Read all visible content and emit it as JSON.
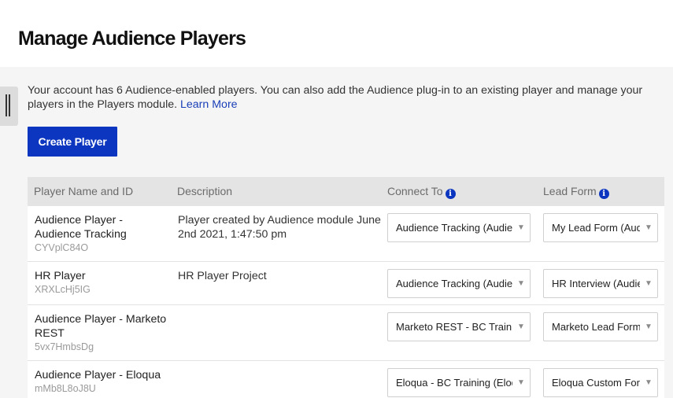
{
  "header": {
    "title": "Manage Audience Players"
  },
  "intro": {
    "text": "Your account has 6 Audience-enabled players. You can also add the Audience plug-in to an existing player and manage your players in the Players module.",
    "link": "Learn More"
  },
  "create_button": "Create Player",
  "table": {
    "columns": {
      "name": "Player Name and ID",
      "description": "Description",
      "connect": "Connect To",
      "lead": "Lead Form"
    },
    "rows": [
      {
        "name": "Audience Player - Audience Tracking",
        "id": "CYVplC84O",
        "description": "Player created by Audience module June 2nd 2021, 1:47:50 pm",
        "connect": "Audience Tracking (Audience)",
        "lead": "My Lead Form (Audience)"
      },
      {
        "name": "HR Player",
        "id": "XRXLcHj5IG",
        "description": "HR Player Project",
        "connect": "Audience Tracking (Audience)",
        "lead": "HR Interview (Audience)"
      },
      {
        "name": "Audience Player - Marketo REST",
        "id": "5vx7HmbsDg",
        "description": "",
        "connect": "Marketo REST - BC Training",
        "lead": "Marketo Lead Form"
      },
      {
        "name": "Audience Player - Eloqua",
        "id": "mMb8L8oJ8U",
        "description": "",
        "connect": "Eloqua - BC Training (Eloqua)",
        "lead": "Eloqua Custom Form"
      }
    ]
  },
  "icons": {
    "info": "info-circle-icon",
    "caret": "caret-down-icon",
    "sidebar": "sidebar-toggle-icon"
  },
  "colors": {
    "accent": "#0c36c0",
    "link": "#1a3fb8"
  }
}
